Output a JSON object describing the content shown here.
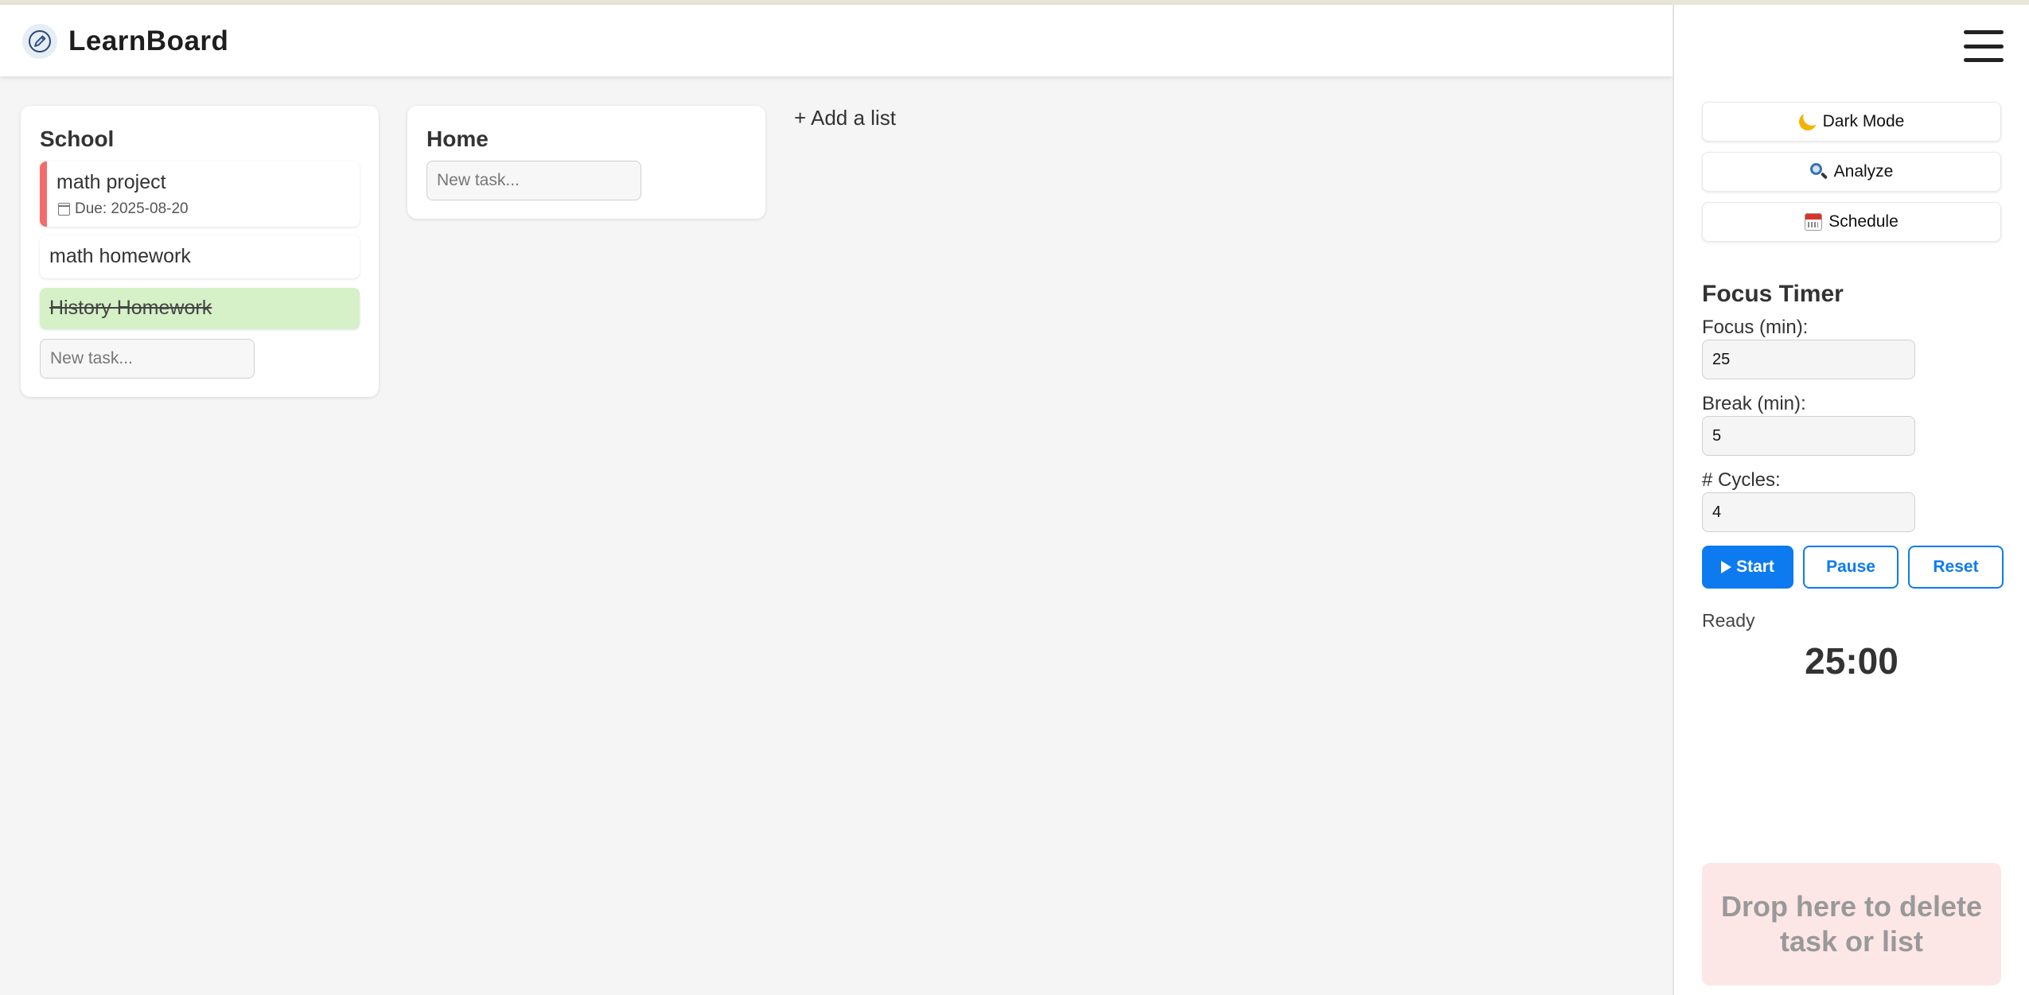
{
  "app": {
    "title": "LearnBoard",
    "logo_icon": "pencil-icon"
  },
  "board": {
    "lists": [
      {
        "title": "School",
        "tasks": [
          {
            "name": "math project",
            "due": "Due: 2025-08-20",
            "priority_color": "#f56b6b"
          },
          {
            "name": "math homework"
          },
          {
            "name": "History Homework",
            "completed": true,
            "completed_color": "#d6f0c8"
          }
        ],
        "new_task_placeholder": "New task..."
      },
      {
        "title": "Home",
        "tasks": [],
        "new_task_placeholder": "New task..."
      }
    ],
    "add_list_label": "+ Add a list"
  },
  "sidebar": {
    "menu_icon": "hamburger-menu-icon",
    "buttons": [
      {
        "label": "Dark Mode",
        "icon": "crescent-moon-icon"
      },
      {
        "label": "Analyze",
        "icon": "magnifying-glass-icon"
      },
      {
        "label": "Schedule",
        "icon": "calendar-icon"
      }
    ],
    "timer": {
      "title": "Focus Timer",
      "focus_label": "Focus (min):",
      "focus_value": "25",
      "break_label": "Break (min):",
      "break_value": "5",
      "cycles_label": "# Cycles:",
      "cycles_value": "4",
      "start_label": "Start",
      "pause_label": "Pause",
      "reset_label": "Reset",
      "status": "Ready",
      "countdown": "25:00"
    },
    "drop_zone_label": "Drop here to delete task or list"
  },
  "colors": {
    "accent": "#0d7bef",
    "background": "#f5f5f5",
    "drop_zone": "#fde6e6"
  }
}
